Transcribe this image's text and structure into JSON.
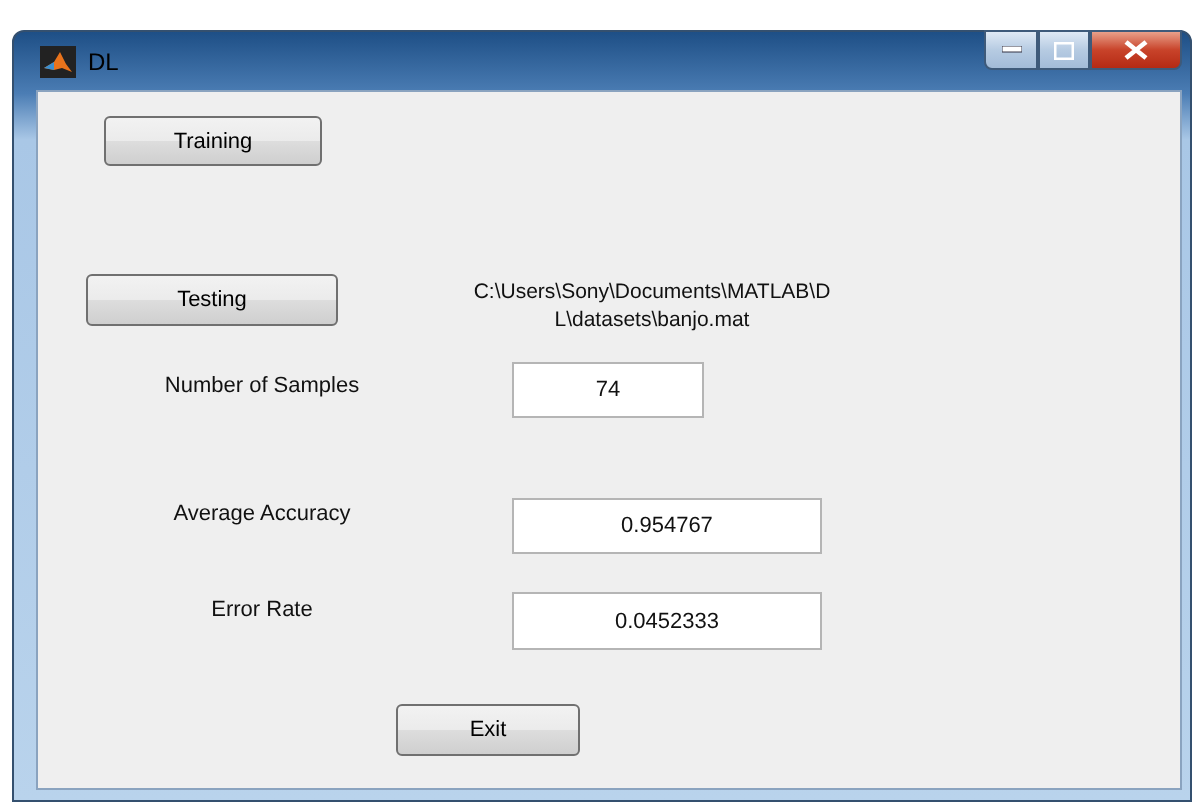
{
  "window": {
    "title": "DL"
  },
  "training_button": "Training",
  "testing_button": "Testing",
  "file_path": {
    "line_1": "C:\\Users\\Sony\\Documents\\MATLAB\\D",
    "line_2": "L\\datasets\\banjo.mat"
  },
  "fields": [
    {
      "label": "Number of Samples",
      "value": "74"
    },
    {
      "label": "Average Accuracy",
      "value": "0.954767"
    },
    {
      "label": "Error Rate",
      "value": "0.0452333"
    }
  ],
  "exit_button": "Exit"
}
